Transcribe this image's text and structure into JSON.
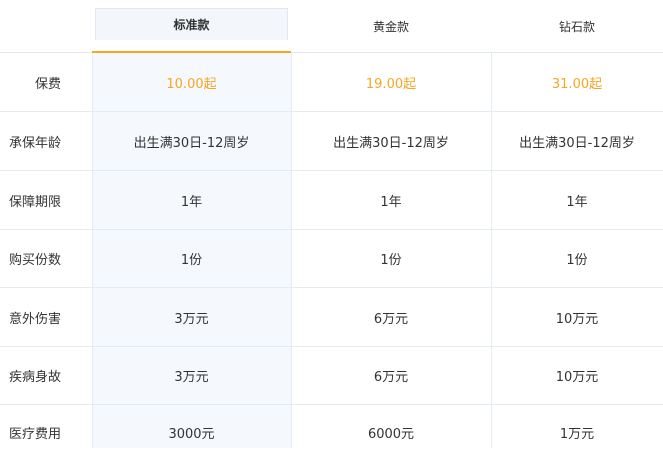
{
  "tabs": [
    {
      "label": "标准款",
      "active": true
    },
    {
      "label": "黄金款",
      "active": false
    },
    {
      "label": "钻石款",
      "active": false
    }
  ],
  "rows": [
    {
      "label": "保费",
      "values": [
        "10.00起",
        "19.00起",
        "31.00起"
      ],
      "highlight": true
    },
    {
      "label": "承保年龄",
      "values": [
        "出生满30日-12周岁",
        "出生满30日-12周岁",
        "出生满30日-12周岁"
      ]
    },
    {
      "label": "保障期限",
      "values": [
        "1年",
        "1年",
        "1年"
      ]
    },
    {
      "label": "购买份数",
      "values": [
        "1份",
        "1份",
        "1份"
      ]
    },
    {
      "label": "意外伤害",
      "values": [
        "3万元",
        "6万元",
        "10万元"
      ]
    },
    {
      "label": "疾病身故",
      "values": [
        "3万元",
        "6万元",
        "10万元"
      ]
    },
    {
      "label": "医疗费用",
      "values": [
        "3000元",
        "6000元",
        "1万元"
      ]
    }
  ],
  "colors": {
    "accent": "#f5a623",
    "active_bg": "#f5f9fd",
    "border": "#e3ebf3"
  }
}
